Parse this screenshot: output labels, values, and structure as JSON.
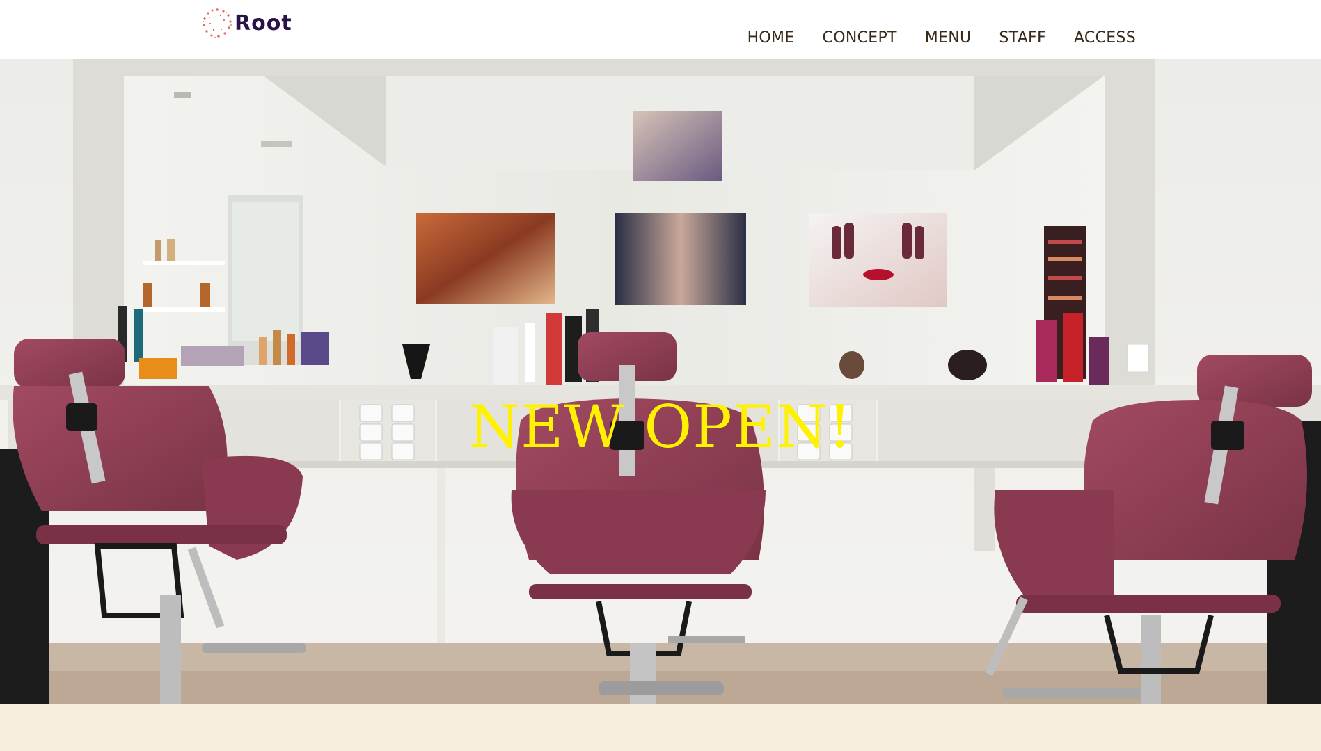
{
  "header": {
    "logo_text": "Root",
    "logo_icon": "dotted-circle-logo-icon",
    "nav": [
      {
        "label": "HOME"
      },
      {
        "label": "CONCEPT"
      },
      {
        "label": "MENU"
      },
      {
        "label": "STAFF"
      },
      {
        "label": "ACCESS"
      }
    ]
  },
  "hero": {
    "title": "NEW OPEN!",
    "title_color": "#fff200",
    "image_subject": "salon-interior-photo"
  },
  "colors": {
    "header_bg": "#ffffff",
    "page_bg": "#f6efdf",
    "logo_text": "#2a1248",
    "nav_text": "#3a2a1c",
    "chair": "#8e3f55"
  }
}
